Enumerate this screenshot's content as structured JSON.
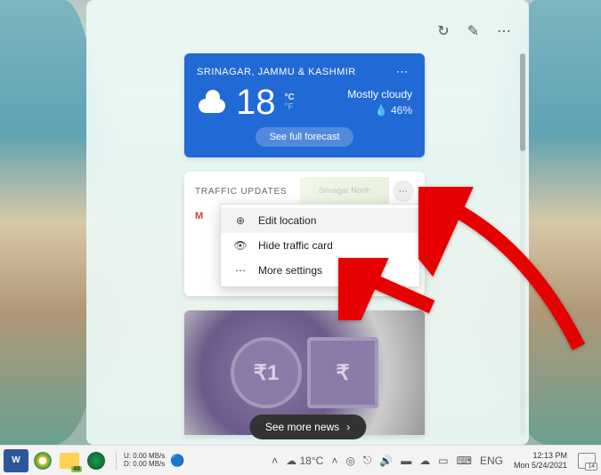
{
  "weather": {
    "location": "SRINAGAR, JAMMU & KASHMIR",
    "temp": "18",
    "unit_c": "°C",
    "unit_f": "°F",
    "condition": "Mostly cloudy",
    "humidity": "46%",
    "forecast_btn": "See full forecast"
  },
  "traffic": {
    "title": "TRAFFIC UPDATES",
    "map_label": "Srinagar North",
    "menu": {
      "edit": "Edit location",
      "hide": "Hide traffic card",
      "more": "More settings"
    }
  },
  "news": {
    "see_more": "See more news"
  },
  "taskbar": {
    "net_up": "0.00 MB/s",
    "net_down": "0.00 MB/s",
    "weather_temp": "18°C",
    "lang": "ENG",
    "time": "12:13 PM",
    "date": "Mon 5/24/2021",
    "explorer_badge": "48",
    "notif_count": "14"
  }
}
